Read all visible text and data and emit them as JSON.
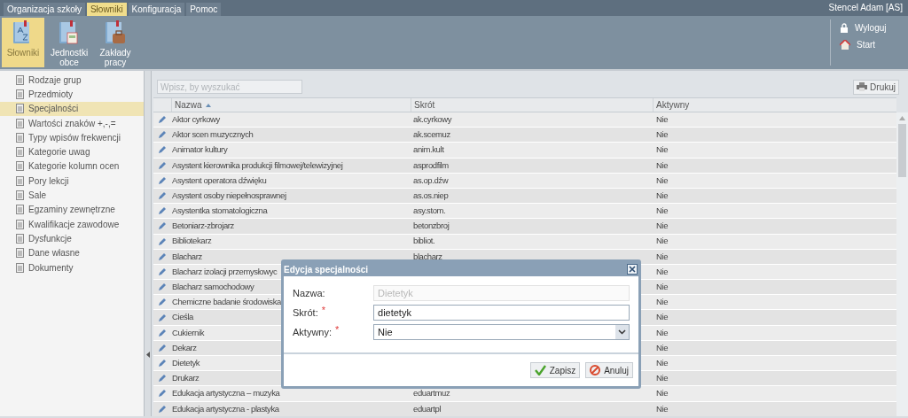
{
  "top_tabs": [
    {
      "label": "Organizacja szkoły",
      "selected": false
    },
    {
      "label": "Słowniki",
      "selected": true
    },
    {
      "label": "Konfiguracja",
      "selected": false
    },
    {
      "label": "Pomoc",
      "selected": false
    }
  ],
  "user": "Stencel Adam [AS]",
  "ribbon": {
    "items": [
      {
        "label": "Słowniki",
        "selected": true,
        "kind": "dictionary"
      },
      {
        "label": "Jednostki obce",
        "selected": false,
        "kind": "units"
      },
      {
        "label": "Zakłady pracy",
        "selected": false,
        "kind": "workplaces"
      }
    ],
    "actions": [
      {
        "label": "Wyloguj",
        "kind": "logout"
      },
      {
        "label": "Start",
        "kind": "home"
      }
    ]
  },
  "sidebar": {
    "items": [
      {
        "label": "Rodzaje grup",
        "selected": false
      },
      {
        "label": "Przedmioty",
        "selected": false
      },
      {
        "label": "Specjalności",
        "selected": true
      },
      {
        "label": "Wartości znaków +,-,=",
        "selected": false
      },
      {
        "label": "Typy wpisów frekwencji",
        "selected": false
      },
      {
        "label": "Kategorie uwag",
        "selected": false
      },
      {
        "label": "Kategorie kolumn ocen",
        "selected": false
      },
      {
        "label": "Pory lekcji",
        "selected": false
      },
      {
        "label": "Sale",
        "selected": false
      },
      {
        "label": "Egzaminy zewnętrzne",
        "selected": false
      },
      {
        "label": "Kwalifikacje zawodowe",
        "selected": false
      },
      {
        "label": "Dysfunkcje",
        "selected": false
      },
      {
        "label": "Dane własne",
        "selected": false
      },
      {
        "label": "Dokumenty",
        "selected": false
      }
    ]
  },
  "grid": {
    "search": {
      "placeholder": "Wpisz, by wyszukać"
    },
    "print_button": "Drukuj",
    "columns": [
      {
        "label": "Nazwa",
        "sorted": true
      },
      {
        "label": "Skrót",
        "sorted": false
      },
      {
        "label": "Aktywny",
        "sorted": false
      }
    ],
    "rows": [
      {
        "name": "Aktor cyrkowy",
        "short": "ak.cyrkowy",
        "active": "Nie"
      },
      {
        "name": "Aktor scen muzycznych",
        "short": "ak.scemuz",
        "active": "Nie"
      },
      {
        "name": "Animator kultury",
        "short": "anim.kult",
        "active": "Nie"
      },
      {
        "name": "Asystent kierownika produkcji filmowej/telewizyjnej",
        "short": "asprodfilm",
        "active": "Nie"
      },
      {
        "name": "Asystent operatora dźwięku",
        "short": "as.op.dźw",
        "active": "Nie"
      },
      {
        "name": "Asystent osoby niepełnosprawnej",
        "short": "as.os.niep",
        "active": "Nie"
      },
      {
        "name": "Asystentka stomatologiczna",
        "short": "asy.stom.",
        "active": "Nie"
      },
      {
        "name": "Betoniarz-zbrojarz",
        "short": "betonzbroj",
        "active": "Nie"
      },
      {
        "name": "Bibliotekarz",
        "short": "bibliot.",
        "active": "Nie"
      },
      {
        "name": "Blacharz",
        "short": "blacharz",
        "active": "Nie"
      },
      {
        "name": "Blacharz izolacji przemysłowyc",
        "active": "Nie"
      },
      {
        "name": "Blacharz samochodowy",
        "active": "Nie"
      },
      {
        "name": "Chemiczne badanie środowiska",
        "active": "Nie"
      },
      {
        "name": "Cieśla",
        "active": "Nie"
      },
      {
        "name": "Cukiernik",
        "active": "Nie"
      },
      {
        "name": "Dekarz",
        "active": "Nie"
      },
      {
        "name": "Dietetyk",
        "active": "Nie"
      },
      {
        "name": "Drukarz",
        "active": "Nie"
      },
      {
        "name": "Edukacja artystyczna – muzyka",
        "short": "eduartmuz",
        "active": "Nie"
      },
      {
        "name": "Edukacja artystyczna - plastyka",
        "short": "eduartpl",
        "active": "Nie"
      }
    ]
  },
  "dialog": {
    "title": "Edycja specjalności",
    "fields": [
      {
        "label": "Nazwa:",
        "kind": "text",
        "value": "Dietetyk",
        "required": false,
        "disabled": true
      },
      {
        "label": "Skrót:",
        "kind": "text",
        "value": "dietetyk",
        "required": true,
        "disabled": false
      },
      {
        "label": "Aktywny:",
        "kind": "select",
        "value": "Nie",
        "required": true,
        "disabled": false
      }
    ],
    "required_mark": "*",
    "buttons": [
      {
        "label": "Zapisz",
        "kind": "save"
      },
      {
        "label": "Anuluj",
        "kind": "cancel"
      }
    ]
  }
}
